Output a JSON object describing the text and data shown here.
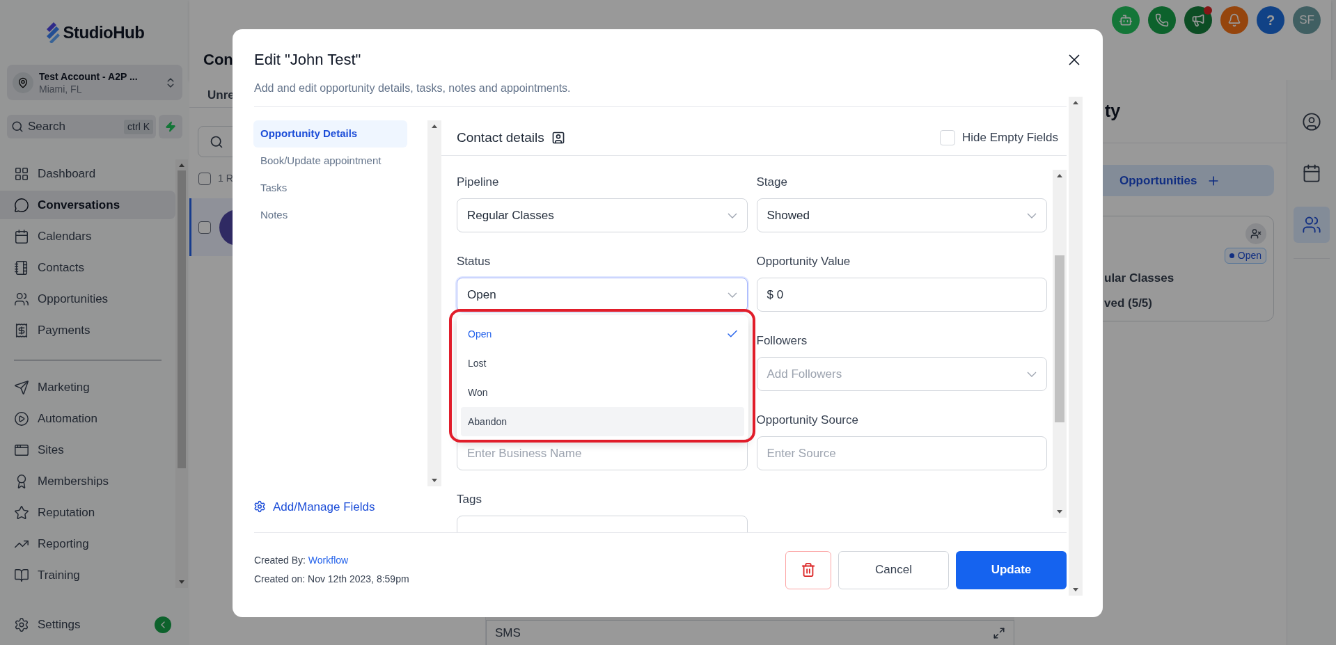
{
  "sidebar": {
    "logo": "StudioHub",
    "account": {
      "name": "Test Account - A2P ...",
      "location": "Miami, FL"
    },
    "search": {
      "placeholder": "Search",
      "shortcut": "ctrl K"
    },
    "nav_primary": [
      {
        "label": "Dashboard",
        "selected": false
      },
      {
        "label": "Conversations",
        "selected": true
      },
      {
        "label": "Calendars",
        "selected": false
      },
      {
        "label": "Contacts",
        "selected": false
      },
      {
        "label": "Opportunities",
        "selected": false
      },
      {
        "label": "Payments",
        "selected": false
      }
    ],
    "nav_secondary": [
      {
        "label": "Marketing",
        "selected": false
      },
      {
        "label": "Automation",
        "selected": false
      },
      {
        "label": "Sites",
        "selected": false
      },
      {
        "label": "Memberships",
        "selected": false
      },
      {
        "label": "Reputation",
        "selected": false
      },
      {
        "label": "Reporting",
        "selected": false
      },
      {
        "label": "Training",
        "selected": false
      }
    ],
    "settings": {
      "label": "Settings"
    }
  },
  "header": {
    "title": "Con",
    "announcements_unread": true,
    "help": "?",
    "avatar": "SF"
  },
  "conversations": {
    "tab": "Unre",
    "select_all": "1 R",
    "select_all_checked": false,
    "row": {
      "selected": true,
      "checked": false
    }
  },
  "composer": {
    "channel": "SMS"
  },
  "right_panel": {
    "title": "ty",
    "add_button": "Opportunities",
    "card": {
      "status": "Open",
      "pipeline": "ular Classes",
      "stage": "ved (5/5)"
    }
  },
  "rail": [
    {
      "selected": false
    },
    {
      "selected": false
    },
    {
      "selected": true
    }
  ],
  "modal": {
    "title": "Edit \"John Test\"",
    "subtitle": "Add and edit opportunity details, tasks, notes and appointments.",
    "nav": [
      {
        "label": "Opportunity Details",
        "selected": true
      },
      {
        "label": "Book/Update appointment",
        "selected": false
      },
      {
        "label": "Tasks",
        "selected": false
      },
      {
        "label": "Notes",
        "selected": false
      }
    ],
    "manage_fields": "Add/Manage Fields",
    "section": {
      "title": "Contact details",
      "hide_empty": {
        "label": "Hide Empty Fields",
        "checked": false
      }
    },
    "rows": [
      {
        "left": {
          "label": "Pipeline",
          "kind": "select",
          "value": "Regular Classes",
          "focused": false
        },
        "right": {
          "label": "Stage",
          "kind": "select",
          "value": "Showed",
          "focused": false
        }
      },
      {
        "left": {
          "label": "Status",
          "kind": "select",
          "value": "Open",
          "focused": true
        },
        "right": {
          "label": "Opportunity Value",
          "kind": "input",
          "value": "$ 0",
          "focused": false
        }
      },
      {
        "right": {
          "label": "Followers",
          "kind": "select",
          "placeholder": "Add Followers",
          "focused": false
        }
      },
      {
        "left": {
          "kind": "input",
          "placeholder": "Enter Business Name",
          "focused": false
        },
        "right": {
          "label": "Opportunity Source",
          "kind": "input",
          "placeholder": "Enter Source",
          "focused": false
        }
      },
      {
        "left": {
          "label": "Tags",
          "kind": "input",
          "focused": false
        }
      }
    ],
    "status_menu": [
      {
        "label": "Open",
        "selected": true,
        "hovered": false
      },
      {
        "label": "Lost",
        "selected": false,
        "hovered": false
      },
      {
        "label": "Won",
        "selected": false,
        "hovered": false
      },
      {
        "label": "Abandon",
        "selected": false,
        "hovered": true
      }
    ],
    "footer": {
      "created_by_label": "Created By:",
      "created_by": "Workflow",
      "created_on": "Created on: Nov 12th 2023, 8:59pm",
      "cancel": "Cancel",
      "update": "Update"
    }
  }
}
